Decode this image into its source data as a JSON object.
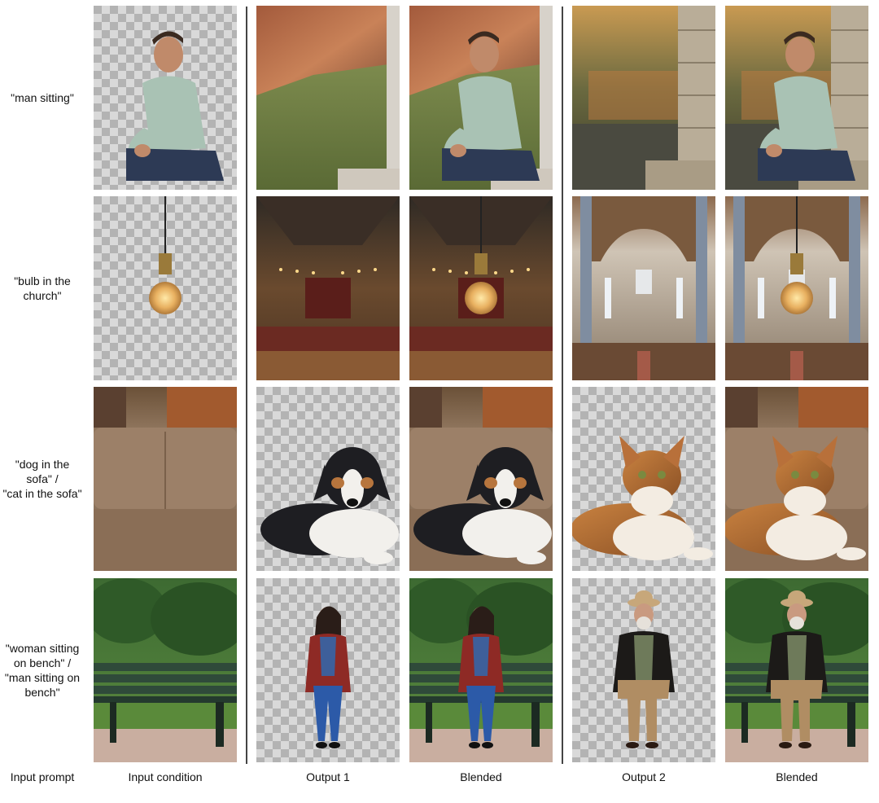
{
  "rows": [
    {
      "prompt": [
        "\"man sitting\""
      ]
    },
    {
      "prompt": [
        "\"bulb in the",
        "church\""
      ]
    },
    {
      "prompt": [
        "\"dog in the",
        "sofa\" /",
        "\"cat in the sofa\""
      ]
    },
    {
      "prompt": [
        "\"woman  sitting",
        "on bench\" /",
        "\"man  sitting on",
        "bench\""
      ]
    }
  ],
  "columns": {
    "input_prompt": "Input prompt",
    "input_condition": "Input condition",
    "output1": "Output 1",
    "blended1": "Blended",
    "output2": "Output 2",
    "blended2": "Blended"
  }
}
